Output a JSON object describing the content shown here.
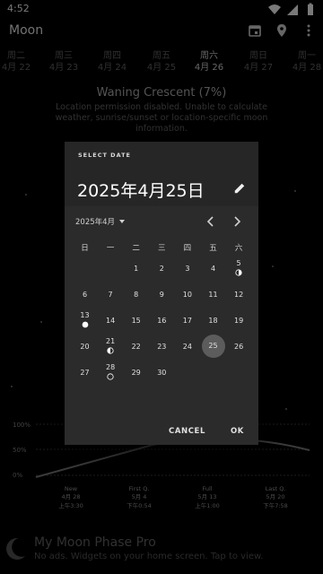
{
  "status": {
    "time": "4:52"
  },
  "appbar": {
    "title": "Moon",
    "icons": [
      "calendar-icon",
      "location-icon",
      "overflow-icon"
    ]
  },
  "days": [
    {
      "wd": "周二",
      "date": "4月 22"
    },
    {
      "wd": "周三",
      "date": "4月 23"
    },
    {
      "wd": "周四",
      "date": "4月 24"
    },
    {
      "wd": "周五",
      "date": "4月 25"
    },
    {
      "wd": "周六",
      "date": "4月 26",
      "selected": true
    },
    {
      "wd": "周日",
      "date": "4月 27"
    },
    {
      "wd": "周一",
      "date": "4月 28"
    }
  ],
  "phase": {
    "title": "Waning Crescent (7%)",
    "warning": "Location permission disabled. Unable to calculate weather, sunrise/sunset or location-specific moon information."
  },
  "graph": {
    "ylabels": [
      "100%",
      "50%",
      "0%"
    ],
    "phases": [
      {
        "name": "New",
        "date": "4月 28",
        "time": "上午3:30"
      },
      {
        "name": "First Q.",
        "date": "5月 4",
        "time": "下午0:54"
      },
      {
        "name": "Full",
        "date": "5月 13",
        "time": "上午1:00"
      },
      {
        "name": "Last Q.",
        "date": "5月 20",
        "time": "下午7:58"
      }
    ]
  },
  "promo": {
    "title": "My Moon Phase Pro",
    "subtitle": "No ads. Widgets on your home screen. Tap to view."
  },
  "dialog": {
    "label": "SELECT DATE",
    "date": "2025年4月25日",
    "month": "2025年4月",
    "weekdays": [
      "日",
      "一",
      "二",
      "三",
      "四",
      "五",
      "六"
    ],
    "cells": [
      {
        "d": "1"
      },
      {
        "d": "2"
      },
      {
        "d": "3"
      },
      {
        "d": "4"
      },
      {
        "d": "5",
        "moon": "first-quarter"
      },
      {
        "d": "6"
      },
      {
        "d": "7"
      },
      {
        "d": "8"
      },
      {
        "d": "9"
      },
      {
        "d": "10"
      },
      {
        "d": "11"
      },
      {
        "d": "12"
      },
      {
        "d": "13",
        "moon": "full"
      },
      {
        "d": "14"
      },
      {
        "d": "15"
      },
      {
        "d": "16"
      },
      {
        "d": "17"
      },
      {
        "d": "18"
      },
      {
        "d": "19"
      },
      {
        "d": "20"
      },
      {
        "d": "21",
        "moon": "last-quarter"
      },
      {
        "d": "22"
      },
      {
        "d": "23"
      },
      {
        "d": "24"
      },
      {
        "d": "25",
        "selected": true
      },
      {
        "d": "26"
      },
      {
        "d": "27"
      },
      {
        "d": "28",
        "moon": "new"
      },
      {
        "d": "29"
      },
      {
        "d": "30"
      }
    ],
    "cancel": "CANCEL",
    "ok": "OK"
  }
}
